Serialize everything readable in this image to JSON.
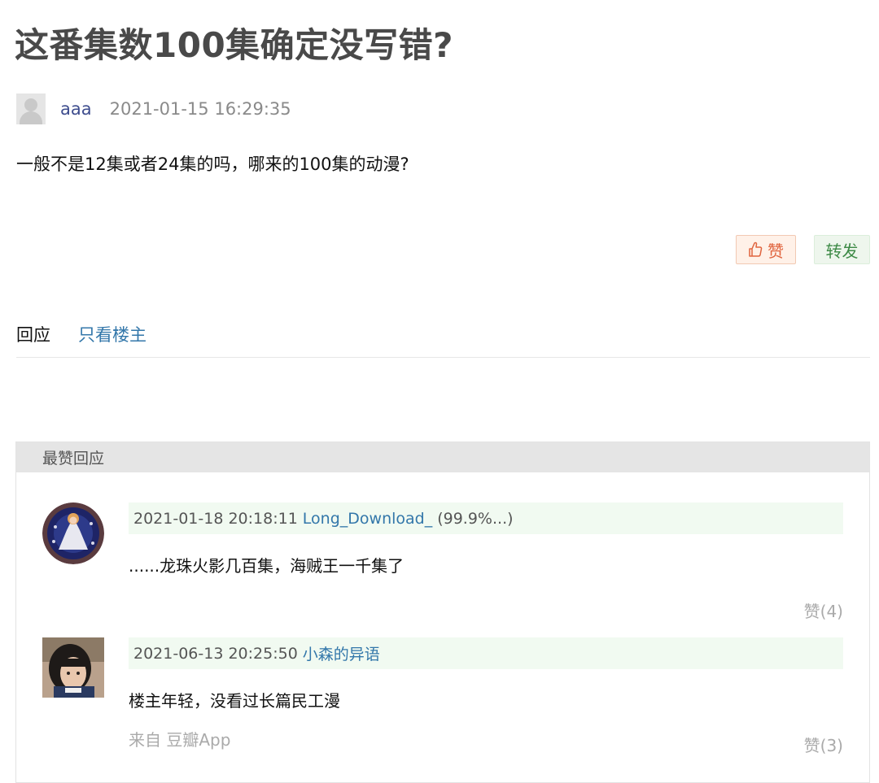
{
  "post": {
    "title": "这番集数100集确定没写错?",
    "author": "aaa",
    "timestamp": "2021-01-15 16:29:35",
    "body": "一般不是12集或者24集的吗，哪来的100集的动漫?"
  },
  "actions": {
    "like_label": "赞",
    "share_label": "转发",
    "like_color": "#e0643e",
    "share_color": "#3d8a46"
  },
  "tabs": {
    "reply_label": "回应",
    "op_only_label": "只看楼主"
  },
  "best_replies": {
    "header": "最赞回应",
    "items": [
      {
        "timestamp": "2021-01-18 20:18:11",
        "user": "Long_Download_",
        "extra": "(99.9%...)",
        "text": "......龙珠火影几百集，海贼王一千集了",
        "source": "",
        "likes": "赞(4)"
      },
      {
        "timestamp": "2021-06-13 20:25:50",
        "user": "小森的异语",
        "extra": "",
        "text": "楼主年轻，没看过长篇民工漫",
        "source": "来自 豆瓣App",
        "likes": "赞(3)"
      }
    ]
  },
  "icons": {
    "author_avatar": "default-user-avatar",
    "like_icon": "thumbs-up-icon"
  }
}
